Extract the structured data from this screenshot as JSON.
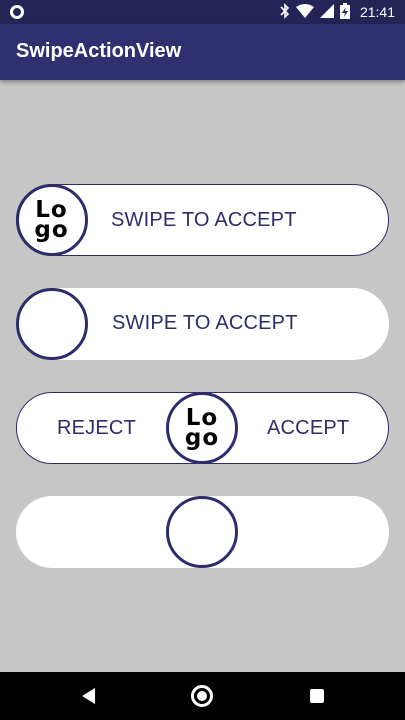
{
  "status_bar": {
    "time": "21:41",
    "icons": [
      "app-notification-icon",
      "bluetooth-icon",
      "wifi-icon",
      "signal-icon",
      "battery-charging-icon"
    ]
  },
  "app_bar": {
    "title": "SwipeActionView"
  },
  "swipe_views": [
    {
      "label": "SWIPE TO ACCEPT",
      "knob_logo": "Lo go"
    },
    {
      "label": "SWIPE TO ACCEPT"
    },
    {
      "left_label": "REJECT",
      "right_label": "ACCEPT",
      "knob_logo": "Lo go"
    },
    {}
  ],
  "colors": {
    "status_bar": "#252456",
    "app_bar": "#303070",
    "accent": "#2d2d6b",
    "background": "#c6c6c6"
  }
}
